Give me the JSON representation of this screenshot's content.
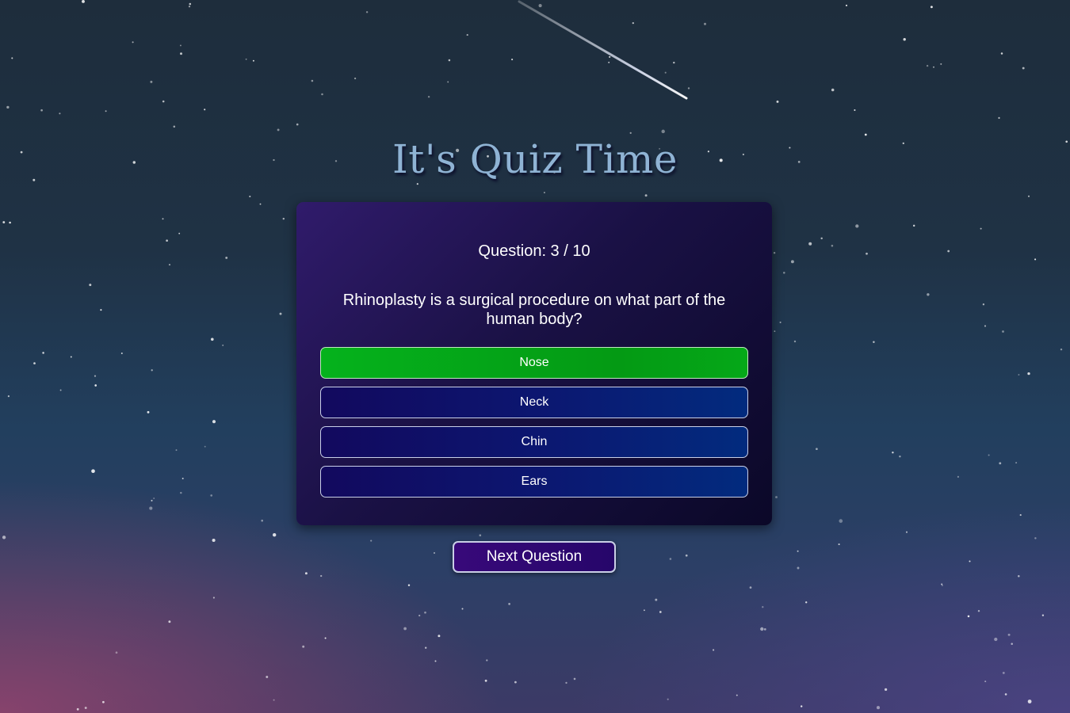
{
  "page": {
    "title": "It's Quiz Time"
  },
  "quiz": {
    "counter": "Question: 3 / 10",
    "question": "Rhinoplasty is a surgical procedure on what part of the human body?",
    "answers": [
      {
        "label": "Nose",
        "state": "correct"
      },
      {
        "label": "Neck",
        "state": "default"
      },
      {
        "label": "Chin",
        "state": "default"
      },
      {
        "label": "Ears",
        "state": "default"
      }
    ],
    "next_label": "Next Question"
  },
  "colors": {
    "correct_green": "#05a818",
    "answer_blue": "#0c1670",
    "card_purple": "#1a1145",
    "next_purple": "#38097a",
    "title_blue": "#8fb3d4"
  }
}
